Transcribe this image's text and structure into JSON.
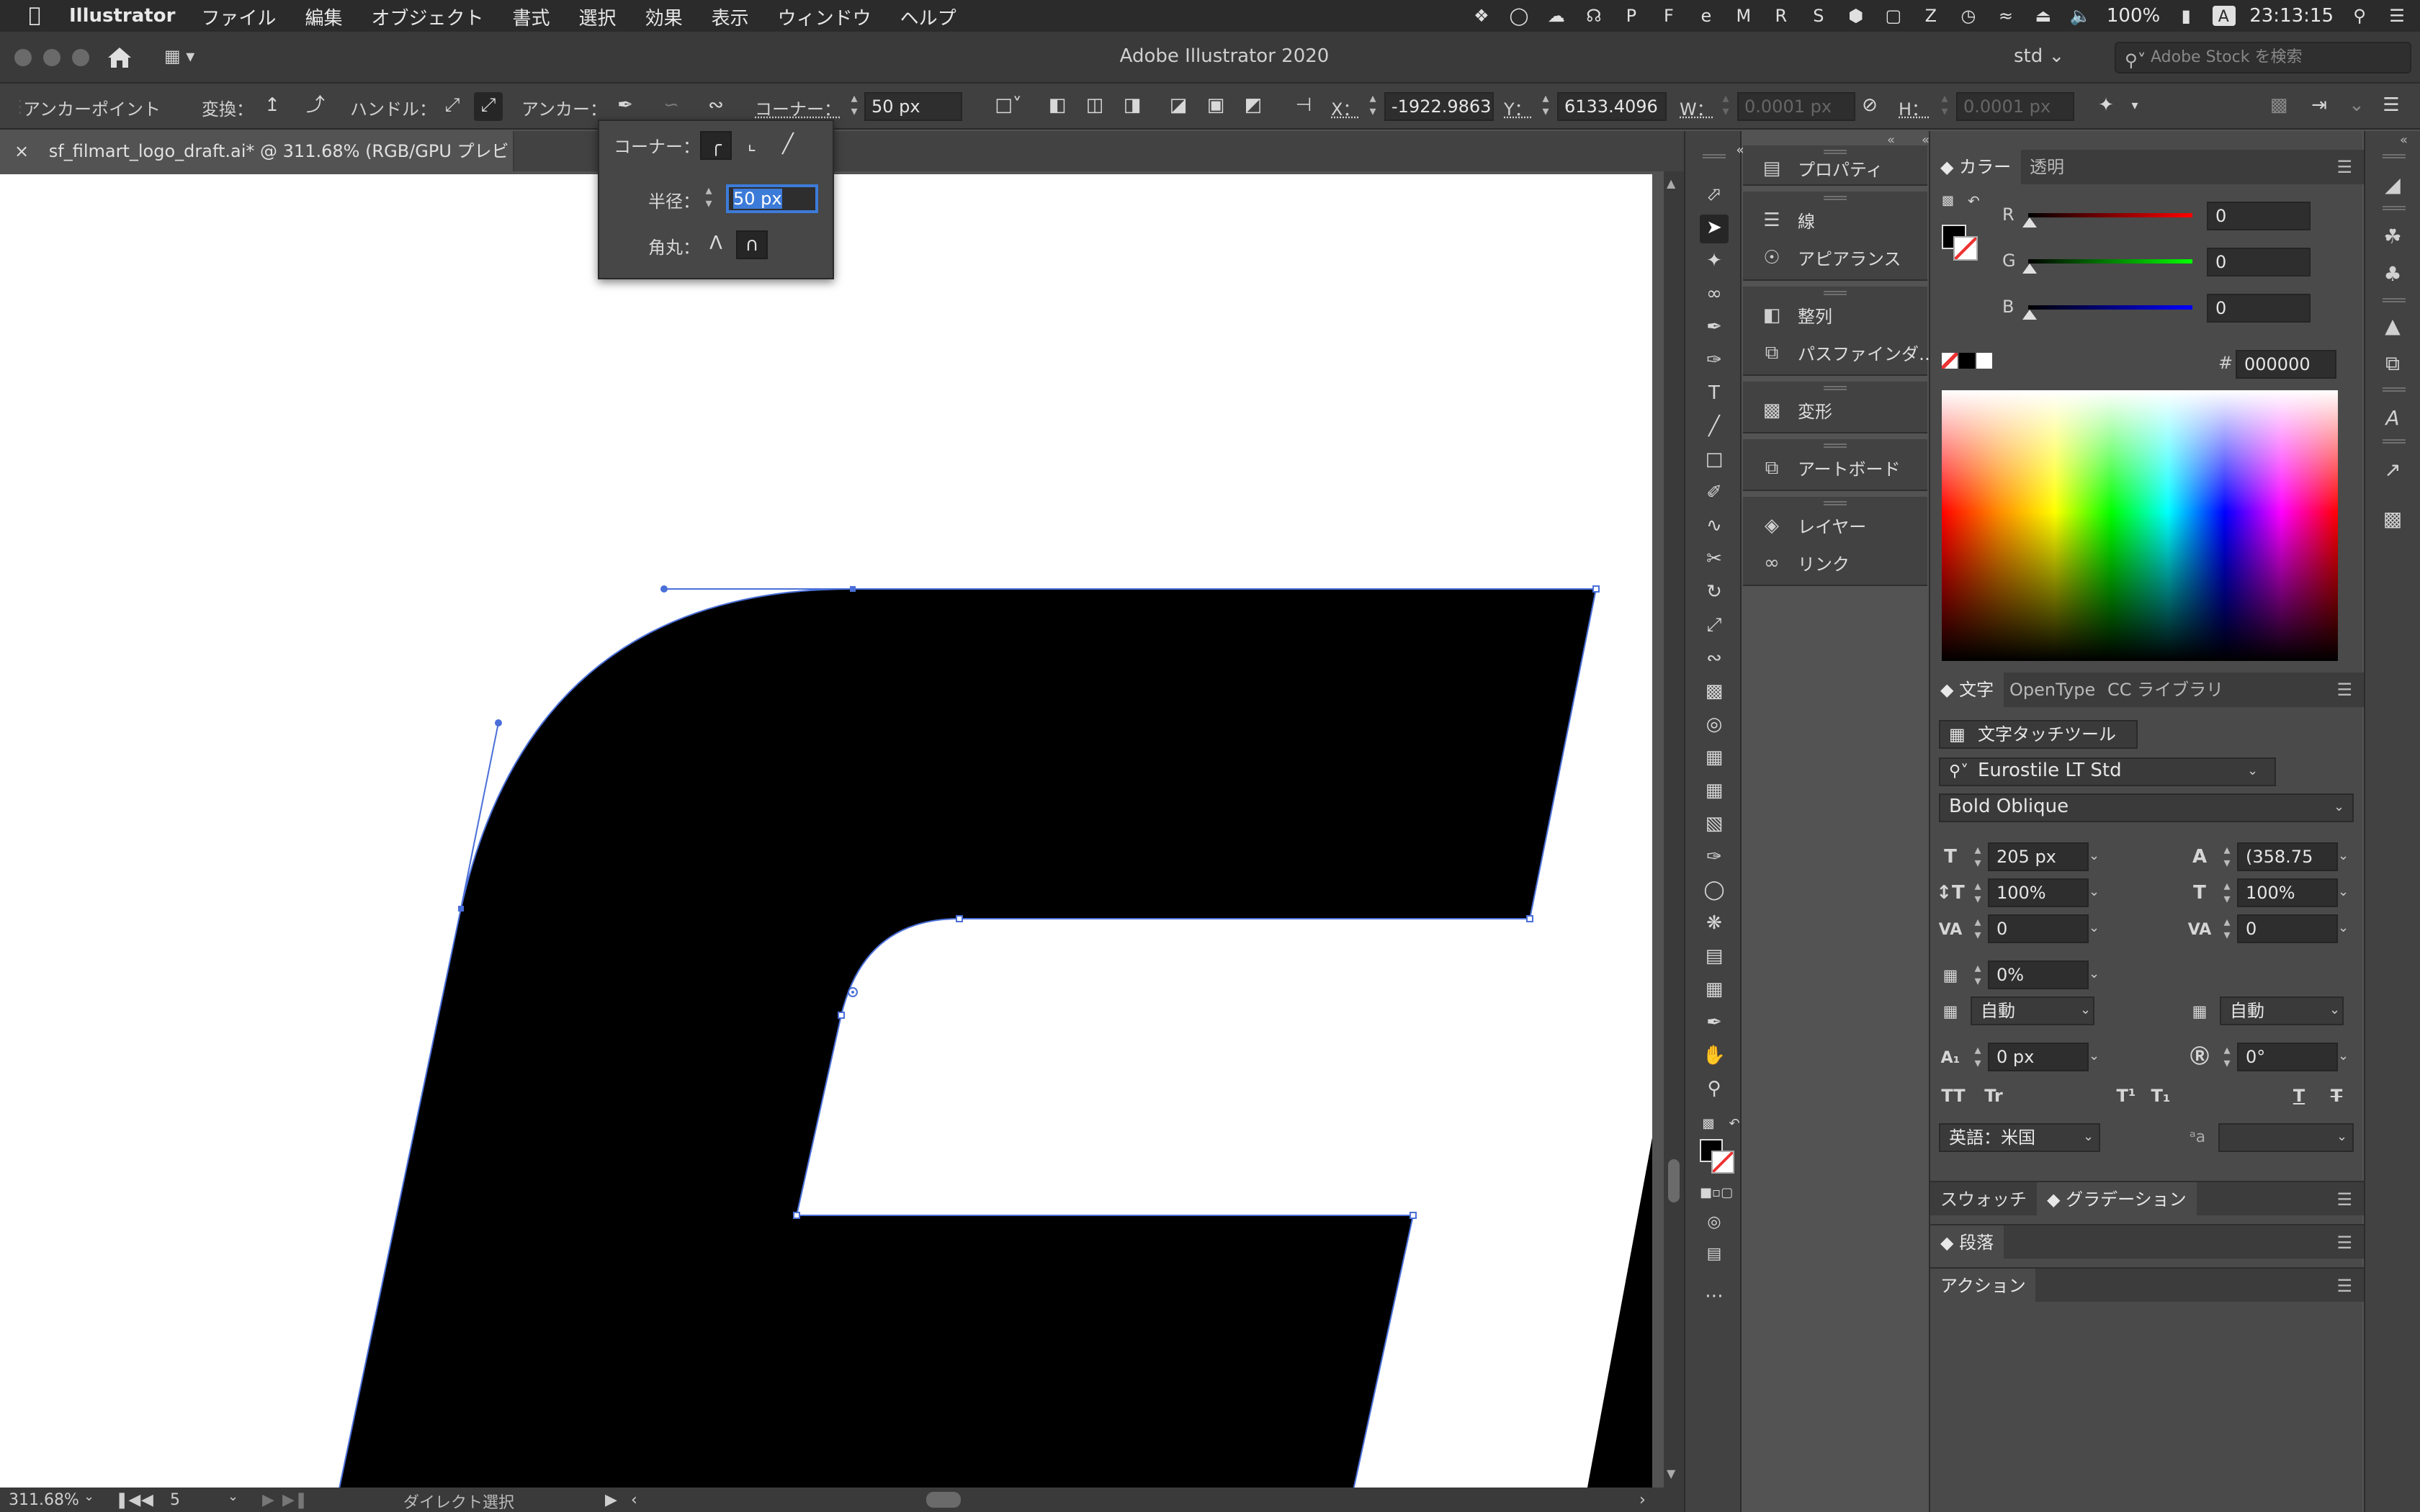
{
  "menubar": {
    "app_name": "Illustrator",
    "items": [
      "ファイル",
      "編集",
      "オブジェクト",
      "書式",
      "選択",
      "効果",
      "表示",
      "ウィンドウ",
      "ヘルプ"
    ],
    "battery": "100%",
    "input_method": "A",
    "clock": "23:13:15"
  },
  "titlebar": {
    "title": "Adobe Illustrator 2020",
    "workspace": "std",
    "stock_placeholder": "Adobe Stock を検索"
  },
  "control": {
    "selection_label": "アンカーポイント",
    "convert_label": "変換：",
    "handle_label": "ハンドル：",
    "anchor_label": "アンカー：",
    "corner_label": "コーナー：",
    "corner_value": "50 px",
    "x_label": "X：",
    "x_value": "-1922.9863",
    "y_label": "Y：",
    "y_value": "6133.4096",
    "w_label": "W：",
    "w_value": "0.0001 px",
    "h_label": "H：",
    "h_value": "0.0001 px"
  },
  "document": {
    "tab_title": "sf_filmart_logo_draft.ai* @ 311.68% (RGB/GPU プレビュー)",
    "close": "×"
  },
  "corner_popup": {
    "corner_label": "コーナー：",
    "radius_label": "半径：",
    "radius_value": "50 px",
    "rounding_label": "角丸："
  },
  "status": {
    "zoom": "311.68%",
    "artboard": "5",
    "tool": "ダイレクト選択"
  },
  "panels": {
    "collapsed": [
      "プロパティ",
      "線",
      "アピアランス",
      "整列",
      "パスファインダ…",
      "変形",
      "アートボード",
      "レイヤー",
      "リンク"
    ]
  },
  "color_panel": {
    "tabs": [
      "カラー",
      "透明"
    ],
    "r_label": "R",
    "r_value": "0",
    "g_label": "G",
    "g_value": "0",
    "b_label": "B",
    "b_value": "0",
    "hex_label": "#",
    "hex_value": "000000"
  },
  "type_panel": {
    "tabs": [
      "文字",
      "OpenType",
      "CC ライブラリ"
    ],
    "touch_tool": "文字タッチツール",
    "font_family": "Eurostile LT Std",
    "font_style": "Bold Oblique",
    "size": "205 px",
    "leading": "(358.75",
    "vscale": "100%",
    "hscale": "100%",
    "kerning": "0",
    "tracking": "0",
    "tsume": "0%",
    "aki_before": "自動",
    "aki_after": "自動",
    "baseline": "0 px",
    "rotation": "0°",
    "language": "英語：米国",
    "aa_label": "a"
  },
  "bottom_panels": {
    "swatch_tab": "スウォッチ",
    "gradient_tab": "グラデーション",
    "paragraph": "段落",
    "actions": "アクション"
  },
  "colors": {
    "accent": "#3d7bd9",
    "path": "#4a6fd8",
    "shape": "#000000",
    "artboard": "#ffffff"
  }
}
